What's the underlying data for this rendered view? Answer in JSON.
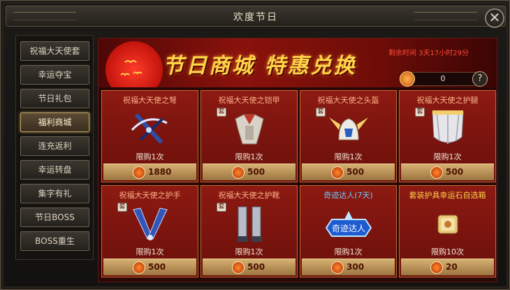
{
  "window": {
    "title": "欢度节日",
    "close_symbol": "✕"
  },
  "sidebar": {
    "items": [
      {
        "label": "祝福大天使套",
        "active": false
      },
      {
        "label": "幸运夺宝",
        "active": false
      },
      {
        "label": "节日礼包",
        "active": false
      },
      {
        "label": "福利商城",
        "active": true
      },
      {
        "label": "连充返利",
        "active": false
      },
      {
        "label": "幸运转盘",
        "active": false
      },
      {
        "label": "集字有礼",
        "active": false
      },
      {
        "label": "节日BOSS",
        "active": false
      },
      {
        "label": "BOSS重生",
        "active": false
      }
    ]
  },
  "banner": {
    "title": "节日商城  特惠兑换",
    "countdown": "剩余时间 3天17小时29分",
    "points_value": "0",
    "help_symbol": "?"
  },
  "cards": [
    {
      "name": "祝福大天使之弩",
      "set_badge": "",
      "limit": "限购1次",
      "price": "1880",
      "art": "crossbow-icon",
      "name_style": ""
    },
    {
      "name": "祝福大天使之铠甲",
      "set_badge": "套",
      "limit": "限购1次",
      "price": "500",
      "art": "armor-icon",
      "name_style": ""
    },
    {
      "name": "祝福大天使之头盔",
      "set_badge": "套",
      "limit": "限购1次",
      "price": "500",
      "art": "helmet-icon",
      "name_style": ""
    },
    {
      "name": "祝福大天使之护腿",
      "set_badge": "套",
      "limit": "限购1次",
      "price": "500",
      "art": "greaves-icon",
      "name_style": ""
    },
    {
      "name": "祝福大天使之护手",
      "set_badge": "套",
      "limit": "限购1次",
      "price": "500",
      "art": "gauntlet-icon",
      "name_style": ""
    },
    {
      "name": "祝福大天使之护靴",
      "set_badge": "套",
      "limit": "限购1次",
      "price": "500",
      "art": "boots-icon",
      "name_style": ""
    },
    {
      "name": "奇迹达人(7天)",
      "set_badge": "",
      "limit": "限购1次",
      "price": "300",
      "art": "title-badge-icon",
      "art_text": "奇迹达人",
      "name_style": "special"
    },
    {
      "name": "套装护具幸运石自选箱",
      "set_badge": "",
      "limit": "限购10次",
      "price": "20",
      "art": "chest-icon",
      "name_style": "gold"
    }
  ],
  "colors": {
    "accent_gold": "#ffd44a",
    "price_bar": "#c8a060",
    "card_bg": "#7e140e",
    "special_name": "#6fc9ff"
  }
}
